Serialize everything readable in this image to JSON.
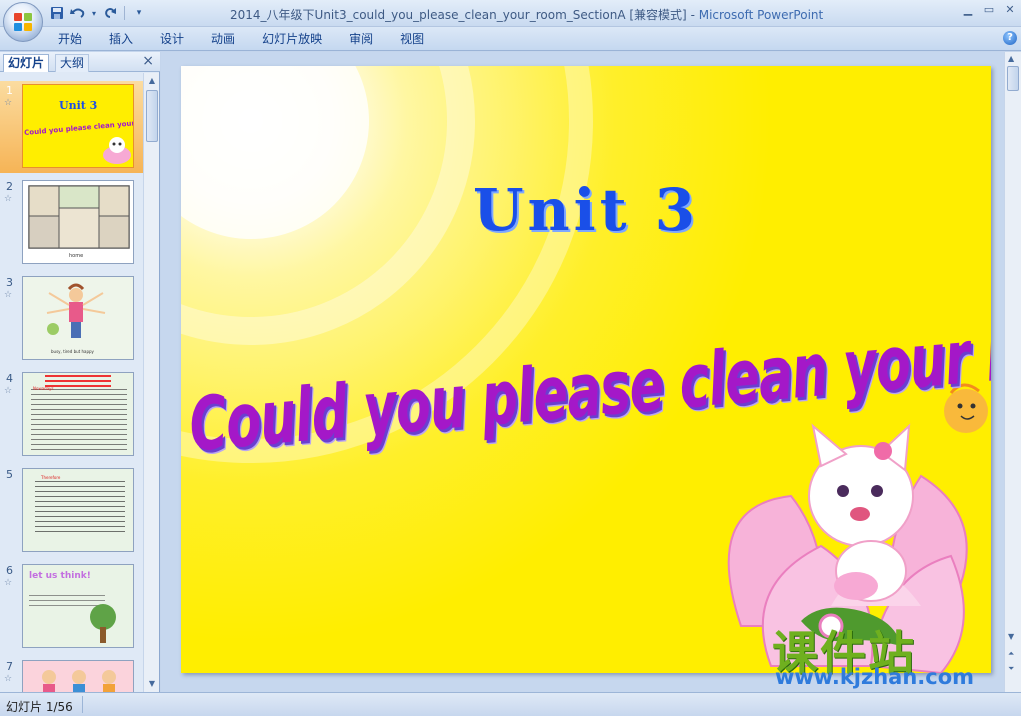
{
  "app": {
    "title_doc": "2014_八年级下Unit3_could_you_please_clean_your_room_SectionA [兼容模式]",
    "title_sep": " - ",
    "title_app": "Microsoft PowerPoint"
  },
  "qat": {
    "save_icon": "save-icon",
    "undo_icon": "undo-icon",
    "redo_icon": "redo-icon",
    "customize_icon": "customize-icon"
  },
  "ribbon": {
    "tabs": [
      {
        "label": "开始"
      },
      {
        "label": "插入"
      },
      {
        "label": "设计"
      },
      {
        "label": "动画"
      },
      {
        "label": "幻灯片放映"
      },
      {
        "label": "审阅"
      },
      {
        "label": "视图"
      }
    ],
    "help": "?"
  },
  "leftpane": {
    "tabs": [
      {
        "label": "幻灯片"
      },
      {
        "label": "大纲"
      }
    ],
    "close": "×",
    "thumbs": [
      {
        "num": "1",
        "title": "Unit 3",
        "sub": "Could you please clean your room?"
      },
      {
        "num": "2",
        "caption": "home"
      },
      {
        "num": "3",
        "caption": "busy, tired but happy"
      },
      {
        "num": "4",
        "heading": "Nowadays"
      },
      {
        "num": "5",
        "heading": "Therefore"
      },
      {
        "num": "6",
        "heading": "let us think!"
      },
      {
        "num": "7"
      }
    ]
  },
  "slide": {
    "title": "Unit 3",
    "subtitle": "Could you please clean your room?",
    "watermark": "课件站",
    "watermark_url": "www.kjzhan.com"
  },
  "status": {
    "text": "幻灯片 1/56"
  },
  "colors": {
    "slide_bg": "#ffee00",
    "title": "#1a4fe8",
    "subtitle": "#a418c8",
    "selection": "#f6b456"
  }
}
